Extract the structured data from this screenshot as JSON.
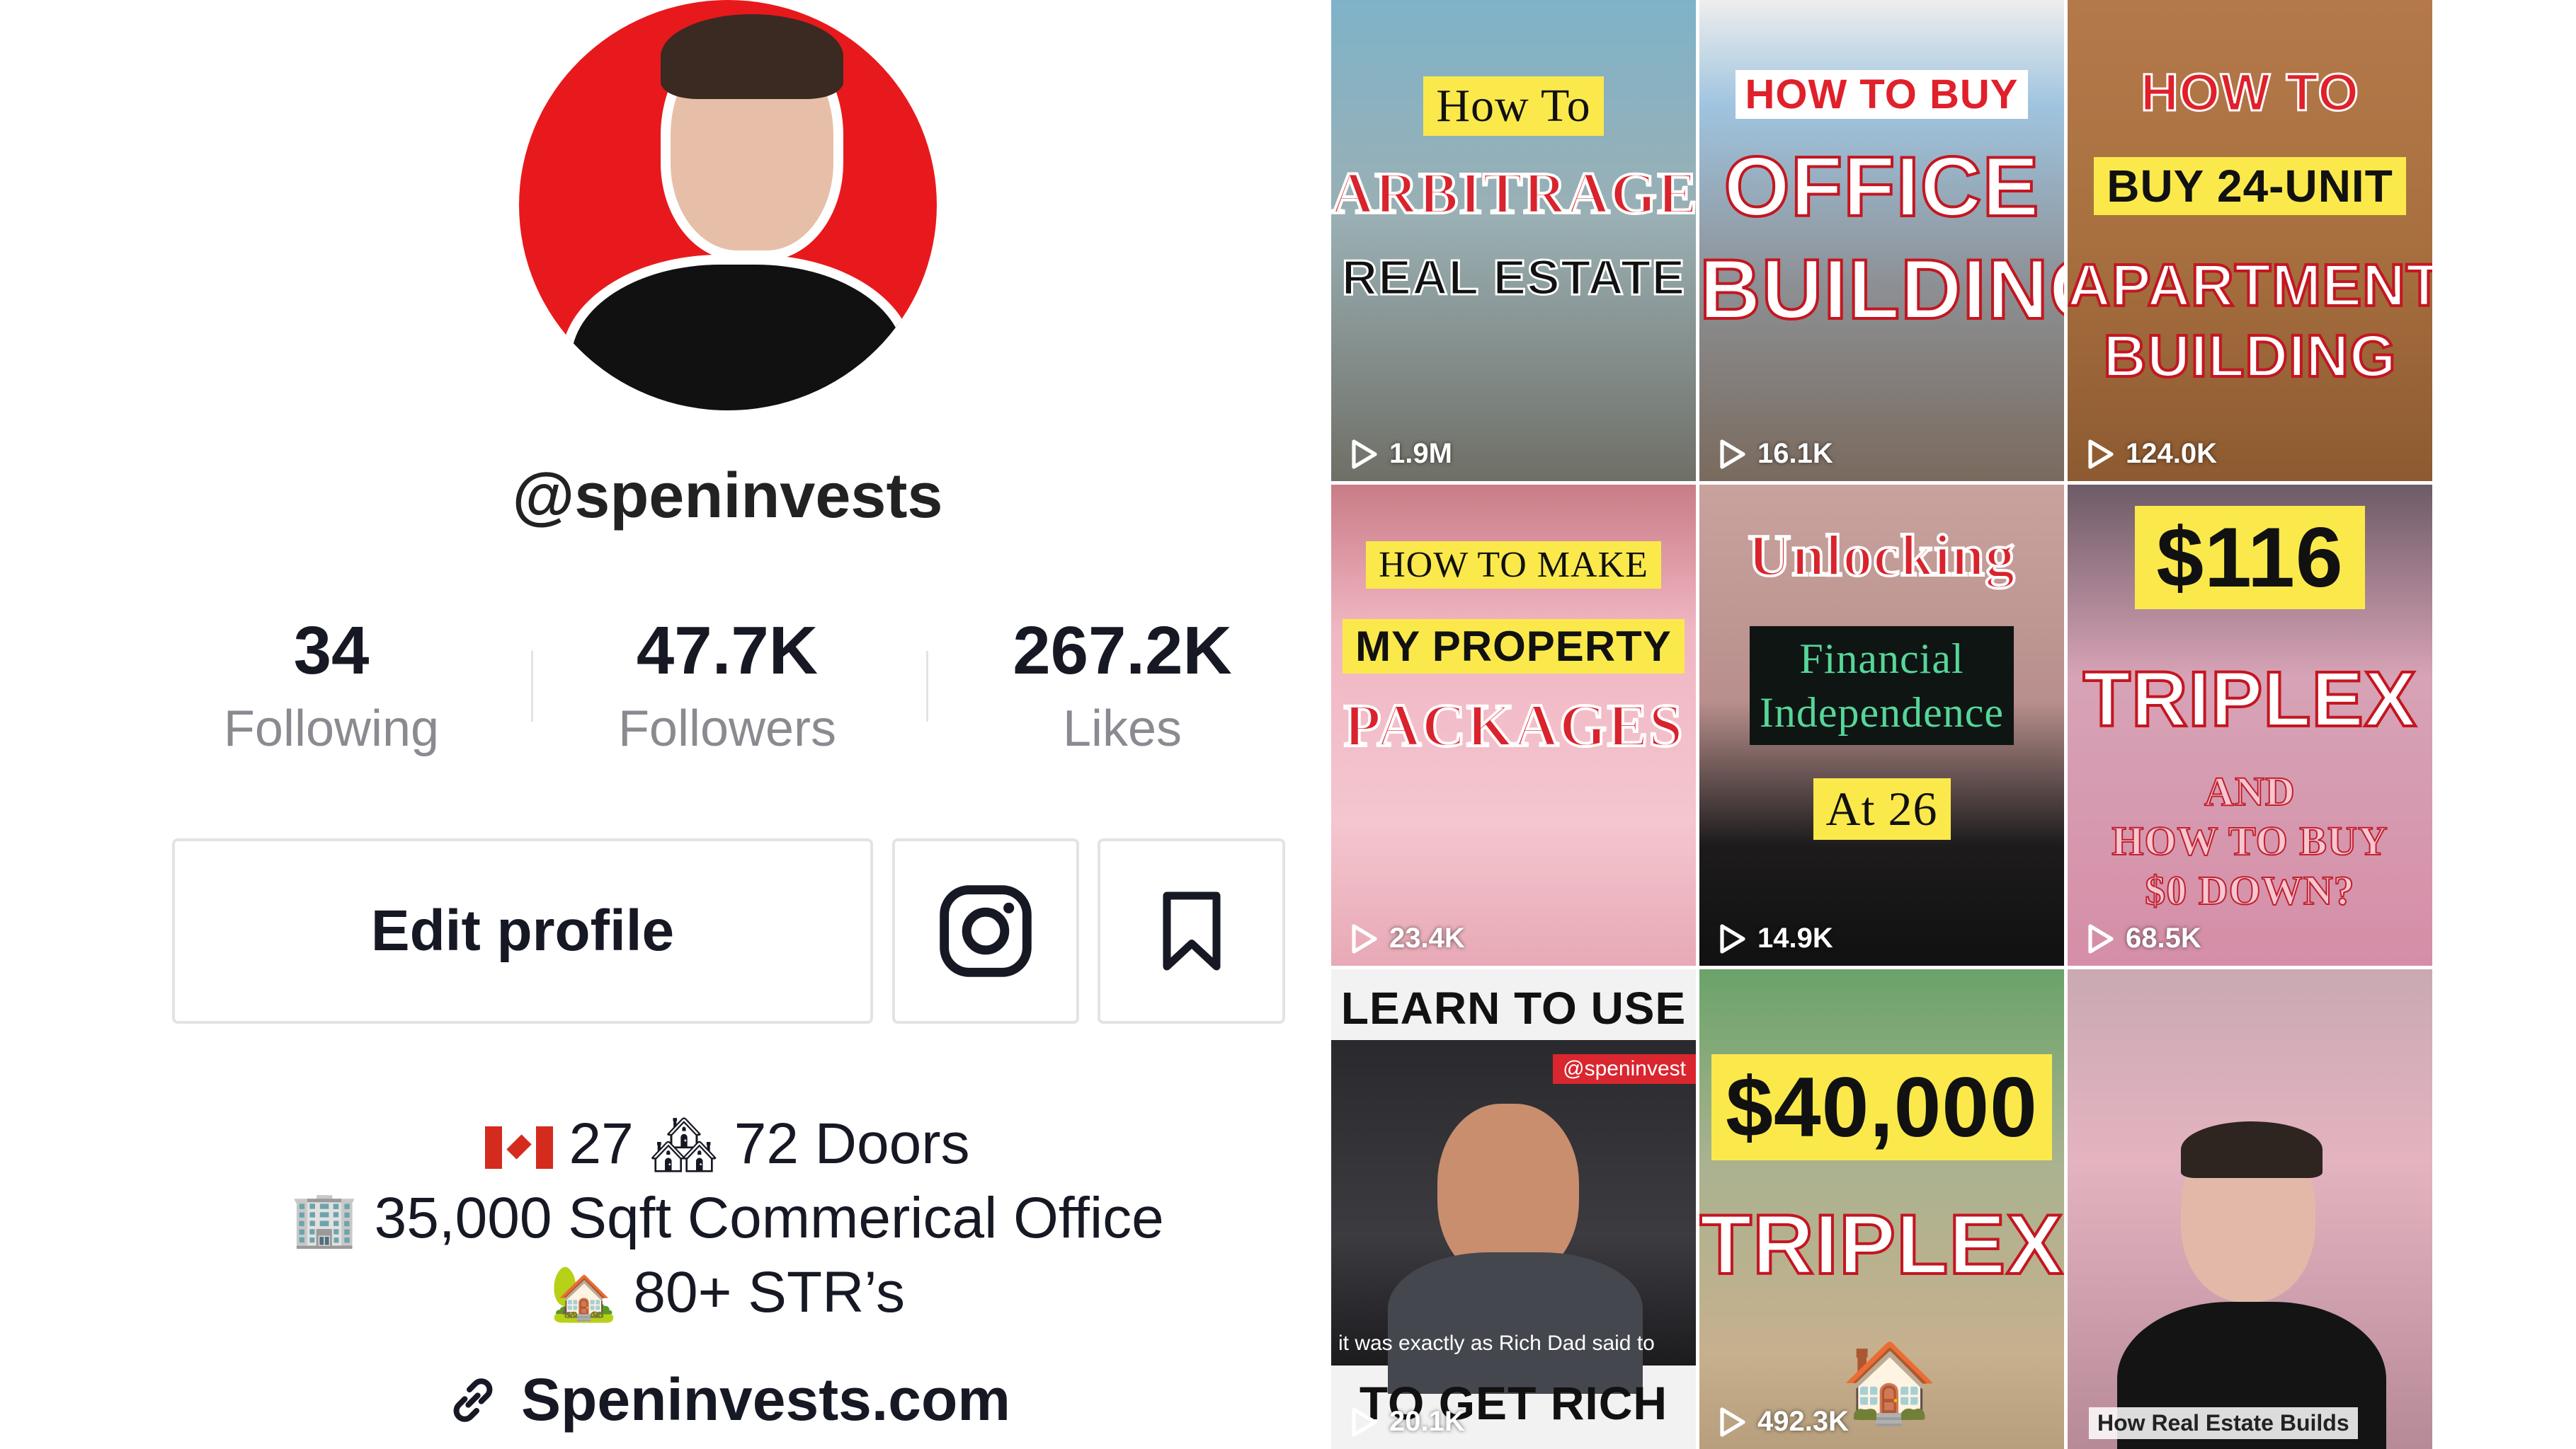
{
  "profile": {
    "handle": "@speninvests",
    "stats": [
      {
        "value": "34",
        "label": "Following"
      },
      {
        "value": "47.7K",
        "label": "Followers"
      },
      {
        "value": "267.2K",
        "label": "Likes"
      }
    ],
    "edit_button": "Edit profile",
    "bio": {
      "line1_a": "27",
      "line1_b": "72 Doors",
      "line2": "35,000 Sqft Commerical Office",
      "line3": "80+ STR’s"
    },
    "link": "Speninvests.com",
    "icons": {
      "flag": "canada-flag-icon",
      "houses": "houses-icon",
      "office": "office-building-icon",
      "house_garden": "house-with-garden-icon",
      "link": "link-icon",
      "instagram": "instagram-icon",
      "bookmark": "bookmark-icon"
    },
    "colors": {
      "avatar_bg": "#e8191c",
      "muted_text": "#8a8b91",
      "border": "#e3e3e4"
    }
  },
  "videos": [
    {
      "lines": [
        "How To",
        "ARBITRAGE",
        "REAL ESTATE"
      ],
      "views": "1.9M"
    },
    {
      "lines": [
        "HOW TO BUY",
        "OFFICE",
        "BUILDING"
      ],
      "views": "16.1K"
    },
    {
      "lines": [
        "HOW TO",
        "BUY 24-UNIT",
        "APARTMENT",
        "BUILDING"
      ],
      "views": "124.0K"
    },
    {
      "lines": [
        "HOW TO MAKE",
        "MY PROPERTY",
        "PACKAGES"
      ],
      "views": "23.4K"
    },
    {
      "lines": [
        "Unlocking",
        "Financial",
        "Independence",
        "At 26"
      ],
      "views": "14.9K"
    },
    {
      "lines": [
        "$116",
        "TRIPLEX",
        "AND",
        "HOW TO BUY",
        "$0 DOWN?"
      ],
      "views": "68.5K"
    },
    {
      "lines": [
        "LEARN TO USE DEBT",
        "@speninvest",
        "it was exactly as Rich Dad said to",
        "TO GET RICH"
      ],
      "views": "20.1K"
    },
    {
      "lines": [
        "$40,000",
        "TRIPLEX"
      ],
      "views": "492.3K"
    },
    {
      "lines": [
        "How Real Estate Builds"
      ],
      "views": ""
    }
  ]
}
